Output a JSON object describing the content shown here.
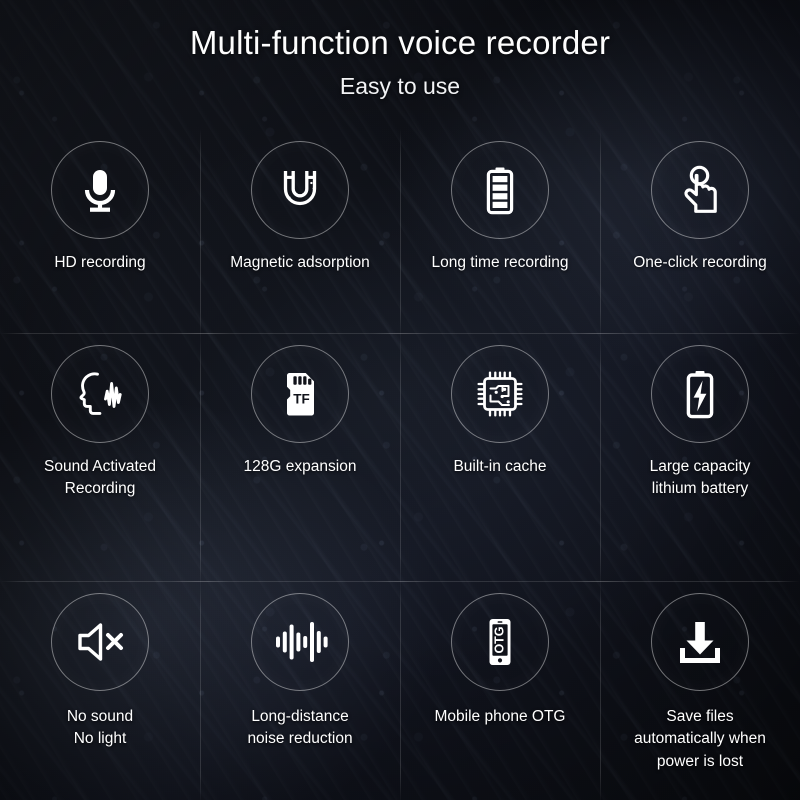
{
  "header": {
    "title": "Multi-function voice recorder",
    "subtitle": "Easy to use"
  },
  "theme": {
    "background_color": "#12141b",
    "text_color": "#ffffff",
    "circle_stroke_color": "rgba(255,255,255,0.42)",
    "divider_color": "rgba(255,255,255,0.13)"
  },
  "features": [
    {
      "id": "hd-recording",
      "icon": "microphone-icon",
      "label": "HD recording"
    },
    {
      "id": "magnetic-adsorption",
      "icon": "magnet-icon",
      "label": "Magnetic adsorption"
    },
    {
      "id": "long-time-recording",
      "icon": "battery-full-icon",
      "label": "Long time recording"
    },
    {
      "id": "one-click-recording",
      "icon": "tap-hand-icon",
      "label": "One-click recording"
    },
    {
      "id": "sound-activated-recording",
      "icon": "voice-profile-icon",
      "label": "Sound Activated\nRecording"
    },
    {
      "id": "128g-expansion",
      "icon": "tf-card-icon",
      "label": "128G expansion"
    },
    {
      "id": "built-in-cache",
      "icon": "chip-icon",
      "label": "Built-in cache"
    },
    {
      "id": "large-capacity-battery",
      "icon": "battery-bolt-icon",
      "label": "Large capacity\nlithium battery"
    },
    {
      "id": "no-sound-no-light",
      "icon": "speaker-mute-icon",
      "label": "No sound\nNo light"
    },
    {
      "id": "noise-reduction",
      "icon": "waveform-icon",
      "label": "Long-distance\nnoise reduction"
    },
    {
      "id": "mobile-phone-otg",
      "icon": "phone-otg-icon",
      "label": "Mobile phone OTG"
    },
    {
      "id": "auto-save-on-power-loss",
      "icon": "download-save-icon",
      "label": "Save files\nautomatically when\npower is lost"
    }
  ],
  "icon_text": {
    "tf_card": "TF",
    "phone_otg": "OTG"
  }
}
